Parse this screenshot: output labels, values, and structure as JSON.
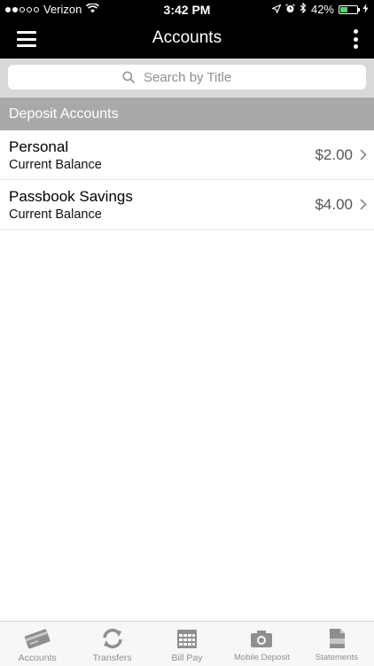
{
  "status_bar": {
    "carrier": "Verizon",
    "time": "3:42 PM",
    "battery_percent": "42%",
    "battery_level": 0.42
  },
  "navbar": {
    "title": "Accounts"
  },
  "search": {
    "placeholder": "Search by Title",
    "value": ""
  },
  "section": {
    "title": "Deposit Accounts"
  },
  "accounts": [
    {
      "name": "Personal",
      "sub": "Current Balance",
      "amount": "$2.00"
    },
    {
      "name": "Passbook Savings",
      "sub": "Current Balance",
      "amount": "$4.00"
    }
  ],
  "tabs": [
    {
      "label": "Accounts",
      "icon": "card-icon"
    },
    {
      "label": "Transfers",
      "icon": "refresh-arrows-icon"
    },
    {
      "label": "Bill Pay",
      "icon": "calendar-icon"
    },
    {
      "label": "Mobile Deposit",
      "icon": "camera-icon"
    },
    {
      "label": "Statements",
      "icon": "pdf-document-icon"
    }
  ],
  "colors": {
    "bar_background": "#000000",
    "section_header": "#a9a9a9",
    "search_background": "#d9d9d9",
    "tab_icon": "#8e8e93"
  }
}
